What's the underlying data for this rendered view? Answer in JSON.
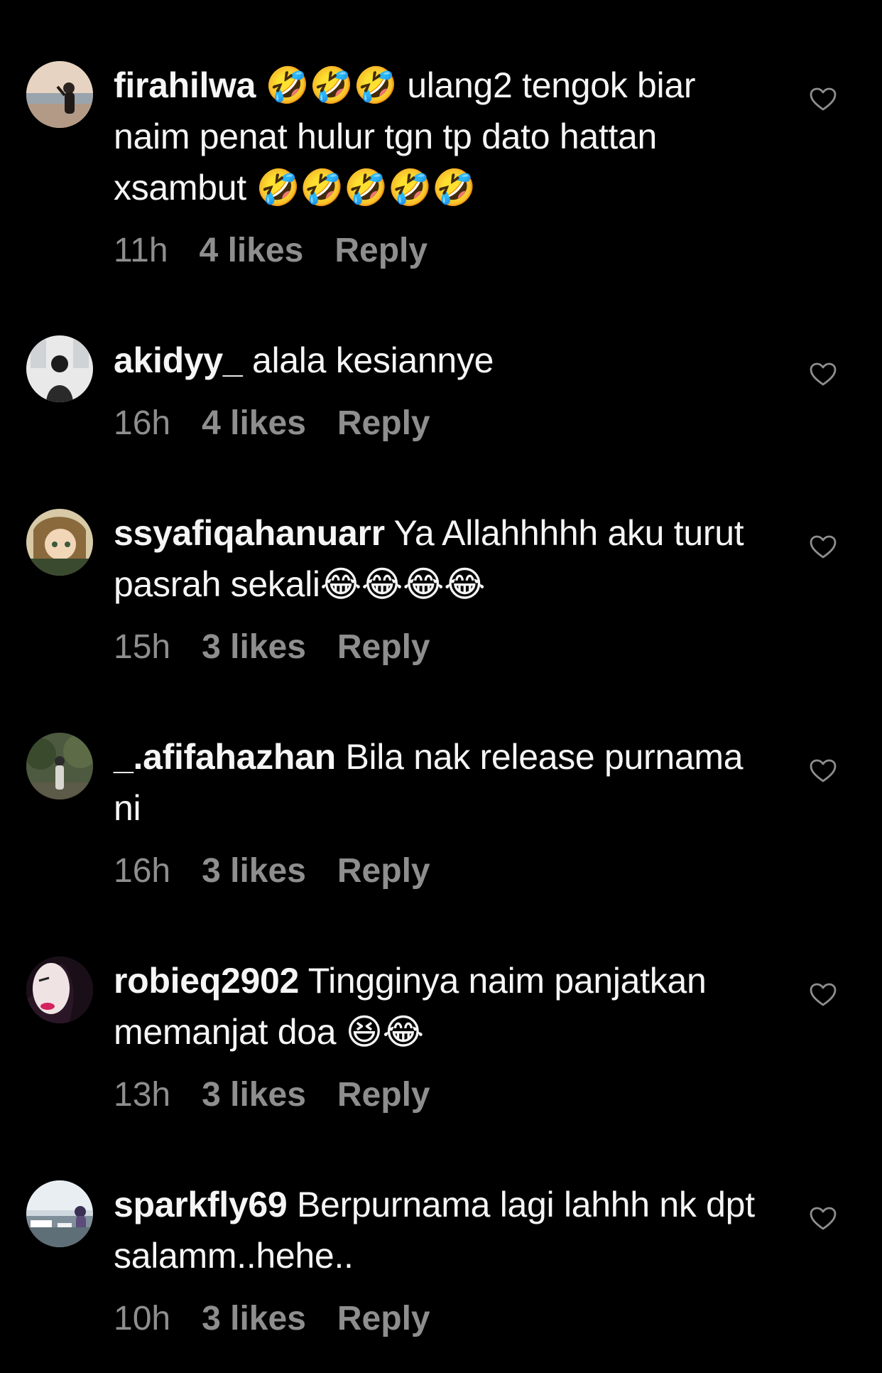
{
  "colors": {
    "background": "#000000",
    "text": "#f5f5f5",
    "meta": "#8e8e8e"
  },
  "comments": [
    {
      "username": "firahilwa",
      "text": "🤣🤣🤣 ulang2 tengok biar naim penat hulur tgn tp dato hattan xsambut 🤣🤣🤣🤣🤣",
      "time": "11h",
      "likes": "4 likes",
      "reply": "Reply",
      "like_icon": "heart-outline-icon"
    },
    {
      "username": "akidyy_",
      "text": "alala kesiannye",
      "time": "16h",
      "likes": "4 likes",
      "reply": "Reply",
      "like_icon": "heart-outline-icon"
    },
    {
      "username": "ssyafiqahanuarr",
      "text": "Ya Allahhhhh aku turut pasrah sekali😂😂😂😂",
      "time": "15h",
      "likes": "3 likes",
      "reply": "Reply",
      "like_icon": "heart-outline-icon"
    },
    {
      "username": "_.afifahazhan",
      "text": "Bila nak release purnama ni",
      "time": "16h",
      "likes": "3 likes",
      "reply": "Reply",
      "like_icon": "heart-outline-icon"
    },
    {
      "username": "robieq2902",
      "text": "Tingginya naim panjatkan memanjat doa 😆😂",
      "time": "13h",
      "likes": "3 likes",
      "reply": "Reply",
      "like_icon": "heart-outline-icon"
    },
    {
      "username": "sparkfly69",
      "text": "Berpurnama lagi lahhh nk dpt salamm..hehe..",
      "time": "10h",
      "likes": "3 likes",
      "reply": "Reply",
      "like_icon": "heart-outline-icon"
    }
  ]
}
